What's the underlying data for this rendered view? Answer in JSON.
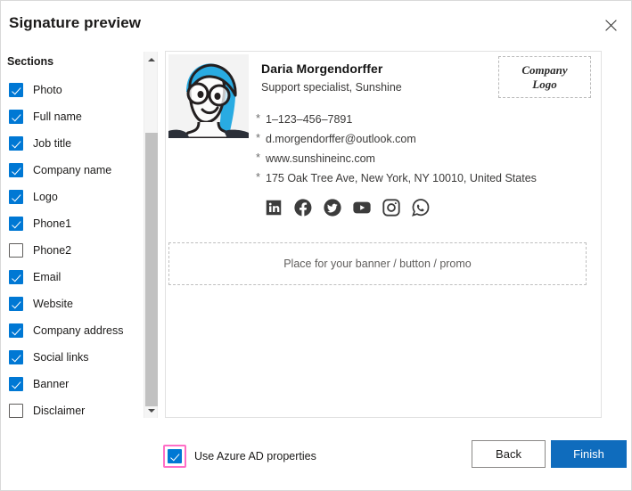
{
  "dialog": {
    "title": "Signature preview",
    "close_icon": "close-icon"
  },
  "sections_panel": {
    "heading": "Sections",
    "items": [
      {
        "label": "Photo",
        "checked": true
      },
      {
        "label": "Full name",
        "checked": true
      },
      {
        "label": "Job title",
        "checked": true
      },
      {
        "label": "Company name",
        "checked": true
      },
      {
        "label": "Logo",
        "checked": true
      },
      {
        "label": "Phone1",
        "checked": true
      },
      {
        "label": "Phone2",
        "checked": false
      },
      {
        "label": "Email",
        "checked": true
      },
      {
        "label": "Website",
        "checked": true
      },
      {
        "label": "Company address",
        "checked": true
      },
      {
        "label": "Social links",
        "checked": true
      },
      {
        "label": "Banner",
        "checked": false
      }
    ],
    "scrollbar": {
      "up_icon": "chevron-up-icon",
      "down_icon": "chevron-down-icon"
    }
  },
  "preview": {
    "avatar_alt": "avatar-photo",
    "name": "Daria Morgendorffer",
    "role": "Support specialist, Sunshine",
    "logo_placeholder_line1": "Company",
    "logo_placeholder_line2": "Logo",
    "bullet": "*",
    "contacts": [
      {
        "type": "phone",
        "value": "1–123–456–7891"
      },
      {
        "type": "email",
        "value": "d.morgendorffer@outlook.com"
      },
      {
        "type": "website",
        "value": "www.sunshineinc.com"
      },
      {
        "type": "address",
        "value": "175 Oak Tree Ave, New York, NY 10010, United States"
      }
    ],
    "social_links": [
      {
        "name": "linkedin-icon"
      },
      {
        "name": "facebook-icon"
      },
      {
        "name": "twitter-icon"
      },
      {
        "name": "youtube-icon"
      },
      {
        "name": "instagram-icon"
      },
      {
        "name": "whatsapp-icon"
      }
    ],
    "banner_placeholder": "Place for your banner / button / promo"
  },
  "footer": {
    "azure_checkbox_label": "Use Azure AD properties",
    "azure_checkbox_checked": true,
    "azure_checkbox_highlight": "#ff6ec7",
    "back_label": "Back",
    "finish_label": "Finish"
  },
  "colors": {
    "accent_blue": "#0078d4",
    "primary_button": "#0f6cbd",
    "social_icon": "#3c3c3c",
    "highlight_pink": "#ff6ec7"
  }
}
